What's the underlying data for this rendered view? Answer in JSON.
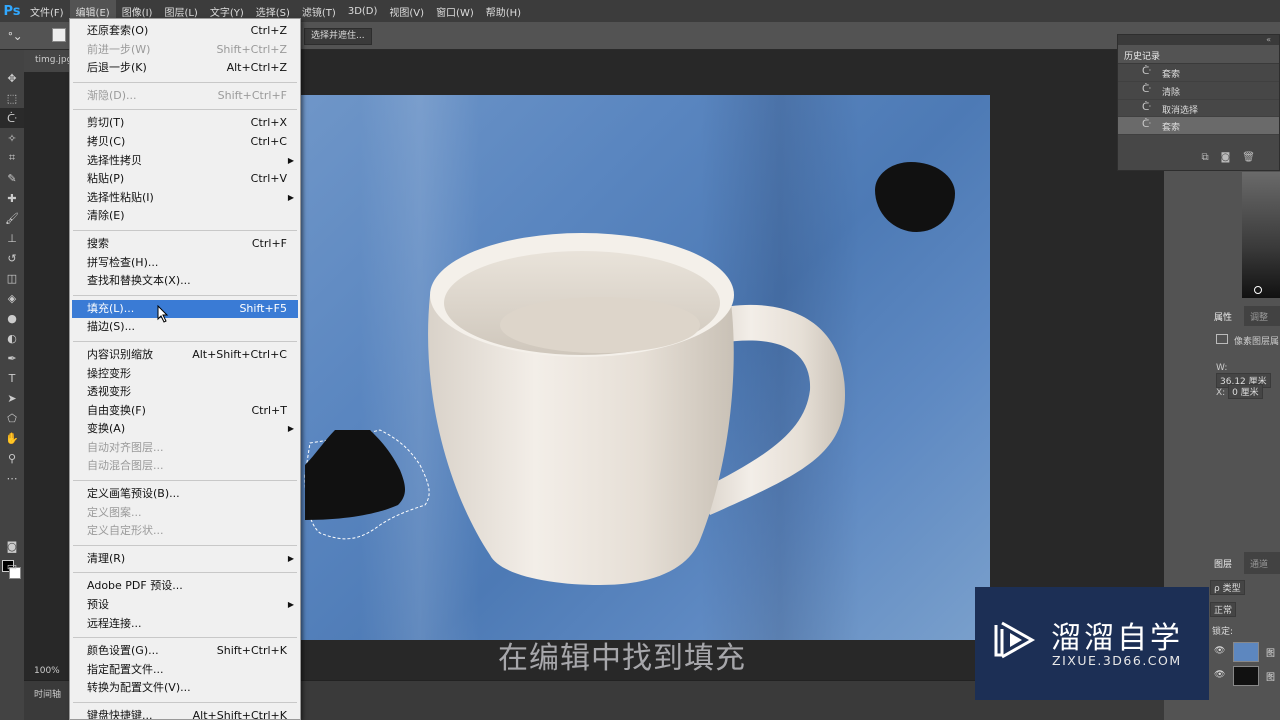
{
  "app": {
    "logo": "Ps"
  },
  "menubar": {
    "items": [
      "文件(F)",
      "编辑(E)",
      "图像(I)",
      "图层(L)",
      "文字(Y)",
      "选择(S)",
      "滤镜(T)",
      "3D(D)",
      "视图(V)",
      "窗口(W)",
      "帮助(H)"
    ]
  },
  "options": {
    "select_and_mask": "选择并遮住..."
  },
  "document": {
    "tab_name": "timg.jpg",
    "zoom": "100%"
  },
  "timeline": {
    "label": "时间轴"
  },
  "edit_menu": {
    "groups": [
      [
        {
          "label": "还原套索(O)",
          "shortcut": "Ctrl+Z",
          "disabled": false
        },
        {
          "label": "前进一步(W)",
          "shortcut": "Shift+Ctrl+Z",
          "disabled": true
        },
        {
          "label": "后退一步(K)",
          "shortcut": "Alt+Ctrl+Z",
          "disabled": false
        }
      ],
      [
        {
          "label": "渐隐(D)...",
          "shortcut": "Shift+Ctrl+F",
          "disabled": true
        }
      ],
      [
        {
          "label": "剪切(T)",
          "shortcut": "Ctrl+X",
          "disabled": false
        },
        {
          "label": "拷贝(C)",
          "shortcut": "Ctrl+C",
          "disabled": false
        },
        {
          "label": "选择性拷贝",
          "shortcut": "",
          "disabled": false,
          "submenu": true
        },
        {
          "label": "粘贴(P)",
          "shortcut": "Ctrl+V",
          "disabled": false
        },
        {
          "label": "选择性粘贴(I)",
          "shortcut": "",
          "disabled": false,
          "submenu": true
        },
        {
          "label": "清除(E)",
          "shortcut": "",
          "disabled": false
        }
      ],
      [
        {
          "label": "搜索",
          "shortcut": "Ctrl+F",
          "disabled": false
        },
        {
          "label": "拼写检查(H)...",
          "shortcut": "",
          "disabled": false
        },
        {
          "label": "查找和替换文本(X)...",
          "shortcut": "",
          "disabled": false
        }
      ],
      [
        {
          "label": "填充(L)...",
          "shortcut": "Shift+F5",
          "disabled": false,
          "highlighted": true
        },
        {
          "label": "描边(S)...",
          "shortcut": "",
          "disabled": false
        }
      ],
      [
        {
          "label": "内容识别缩放",
          "shortcut": "Alt+Shift+Ctrl+C",
          "disabled": false
        },
        {
          "label": "操控变形",
          "shortcut": "",
          "disabled": false
        },
        {
          "label": "透视变形",
          "shortcut": "",
          "disabled": false
        },
        {
          "label": "自由变换(F)",
          "shortcut": "Ctrl+T",
          "disabled": false
        },
        {
          "label": "变换(A)",
          "shortcut": "",
          "disabled": false,
          "submenu": true
        },
        {
          "label": "自动对齐图层...",
          "shortcut": "",
          "disabled": true
        },
        {
          "label": "自动混合图层...",
          "shortcut": "",
          "disabled": true
        }
      ],
      [
        {
          "label": "定义画笔预设(B)...",
          "shortcut": "",
          "disabled": false
        },
        {
          "label": "定义图案...",
          "shortcut": "",
          "disabled": true
        },
        {
          "label": "定义自定形状...",
          "shortcut": "",
          "disabled": true
        }
      ],
      [
        {
          "label": "清理(R)",
          "shortcut": "",
          "disabled": false,
          "submenu": true
        }
      ],
      [
        {
          "label": "Adobe PDF 预设...",
          "shortcut": "",
          "disabled": false
        },
        {
          "label": "预设",
          "shortcut": "",
          "disabled": false,
          "submenu": true
        },
        {
          "label": "远程连接...",
          "shortcut": "",
          "disabled": false
        }
      ],
      [
        {
          "label": "颜色设置(G)...",
          "shortcut": "Shift+Ctrl+K",
          "disabled": false
        },
        {
          "label": "指定配置文件...",
          "shortcut": "",
          "disabled": false
        },
        {
          "label": "转换为配置文件(V)...",
          "shortcut": "",
          "disabled": false
        }
      ],
      [
        {
          "label": "键盘快捷键...",
          "shortcut": "Alt+Shift+Ctrl+K",
          "disabled": false
        }
      ]
    ]
  },
  "history": {
    "title": "历史记录",
    "items": [
      "套索",
      "清除",
      "取消选择",
      "套索"
    ]
  },
  "properties": {
    "tab_properties": "属性",
    "tab_adjust": "调整",
    "layer_type": "像素图层属",
    "w_label": "W:",
    "w_value": "36.12 厘米",
    "x_label": "X:",
    "x_value": "0 厘米"
  },
  "layers": {
    "tab_layers": "图层",
    "tab_channels": "通道",
    "kind": "ρ 类型",
    "blend": "正常",
    "lock": "锁定:",
    "layer_names": [
      "图",
      "图"
    ]
  },
  "caption": "在编辑中找到填充",
  "watermark": {
    "title": "溜溜自学",
    "sub": "ZIXUE.3D66.COM"
  }
}
